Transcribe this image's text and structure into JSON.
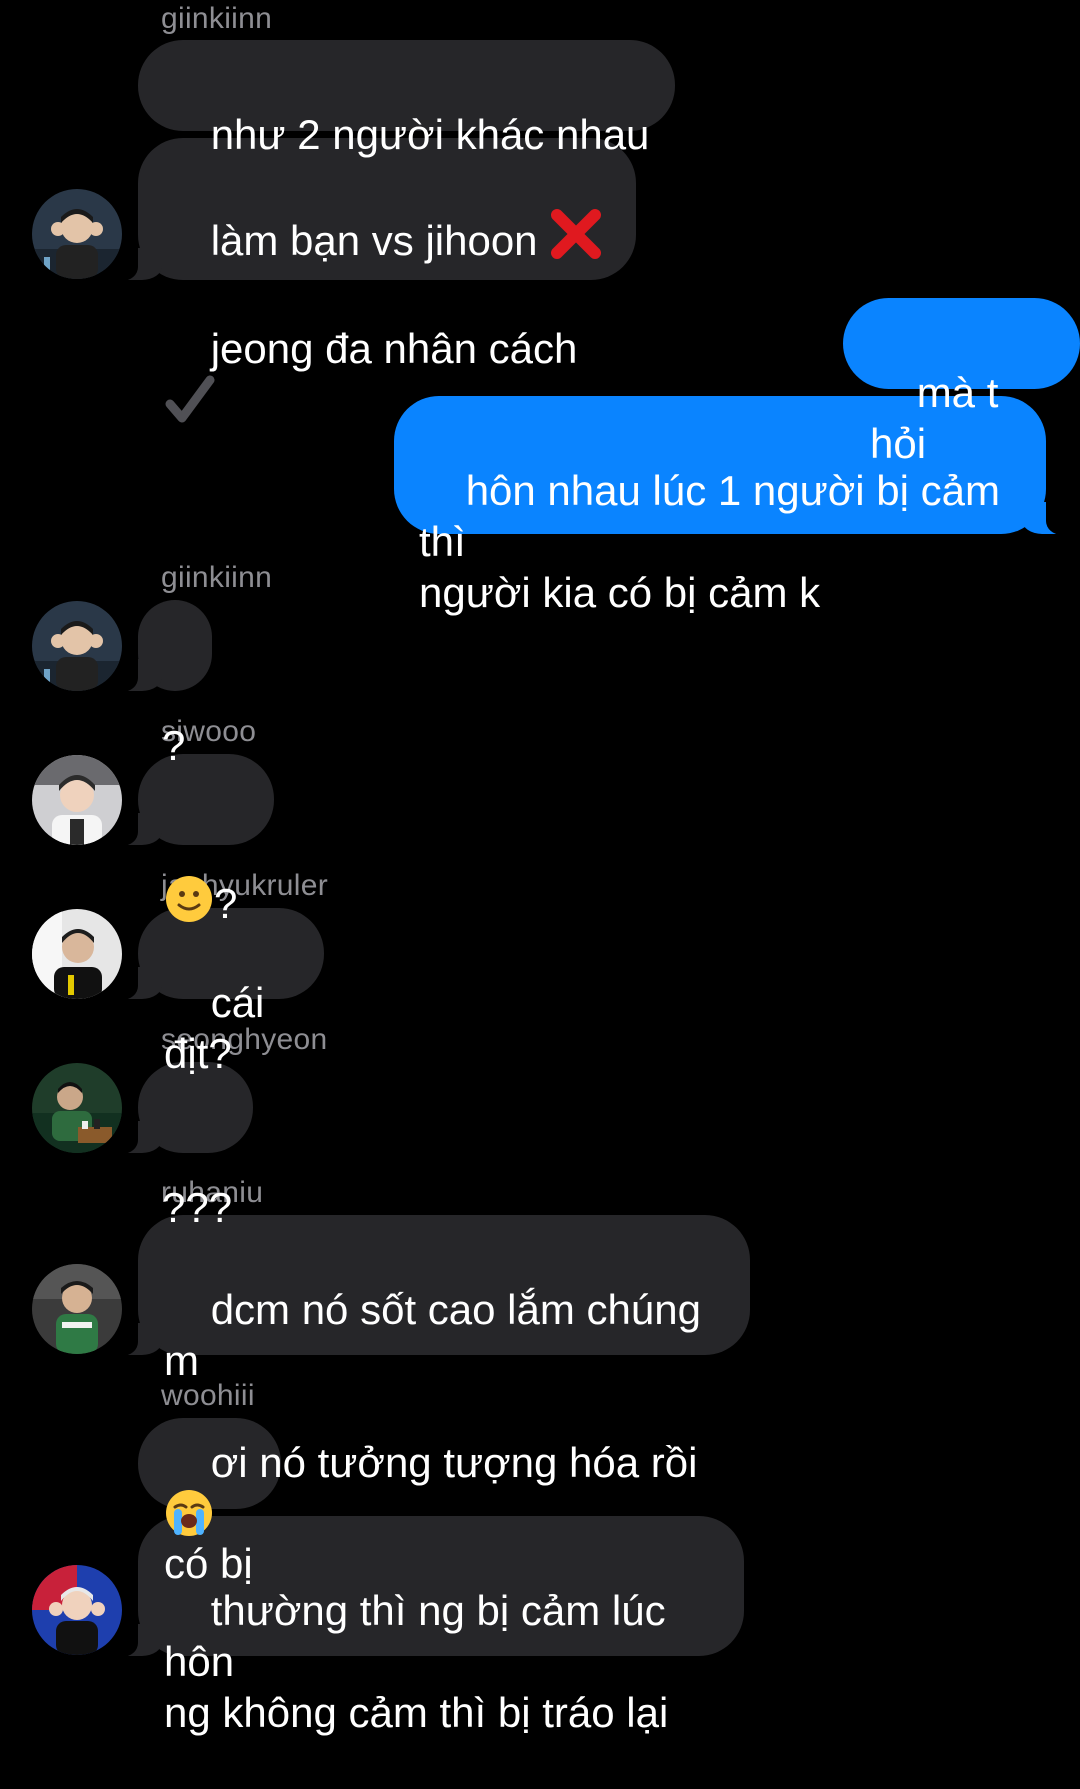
{
  "messages": [
    {
      "sender": "giinkiinn",
      "text": "như 2 người khác nhau"
    },
    {
      "text_line1": "làm bạn vs jihoon",
      "text_line2": "jeong đa nhân cách",
      "icons": [
        "red-cross-icon",
        "check-mark-icon"
      ]
    },
    {
      "outgoing": true,
      "text": "mà t hỏi"
    },
    {
      "outgoing": true,
      "text": "hôn nhau lúc 1 người bị cảm thì\nngười kia có bị cảm k"
    },
    {
      "sender": "giinkiinn",
      "text": "?"
    },
    {
      "sender": "siwooo",
      "text": "?",
      "icons": [
        "slightly-smiling-face-emoji"
      ]
    },
    {
      "sender": "jaehyukruler",
      "text": "cái địt?"
    },
    {
      "sender": "seonghyeon",
      "text": "???"
    },
    {
      "sender": "ruhaniu",
      "text_line1": "dcm nó sốt cao lắm chúng m",
      "text_line2": "ơi nó tưởng tượng hóa rồi",
      "icons": [
        "loudly-crying-face-emoji"
      ]
    },
    {
      "sender": "woohiii",
      "text": "có bị"
    },
    {
      "text": "thường thì ng bị cảm lúc hôn\nng không cảm thì bị tráo lại"
    }
  ],
  "colors": {
    "background": "#000000",
    "incoming_bubble": "#262629",
    "outgoing_bubble": "#0a84ff",
    "sender_name": "#8e8e93"
  }
}
